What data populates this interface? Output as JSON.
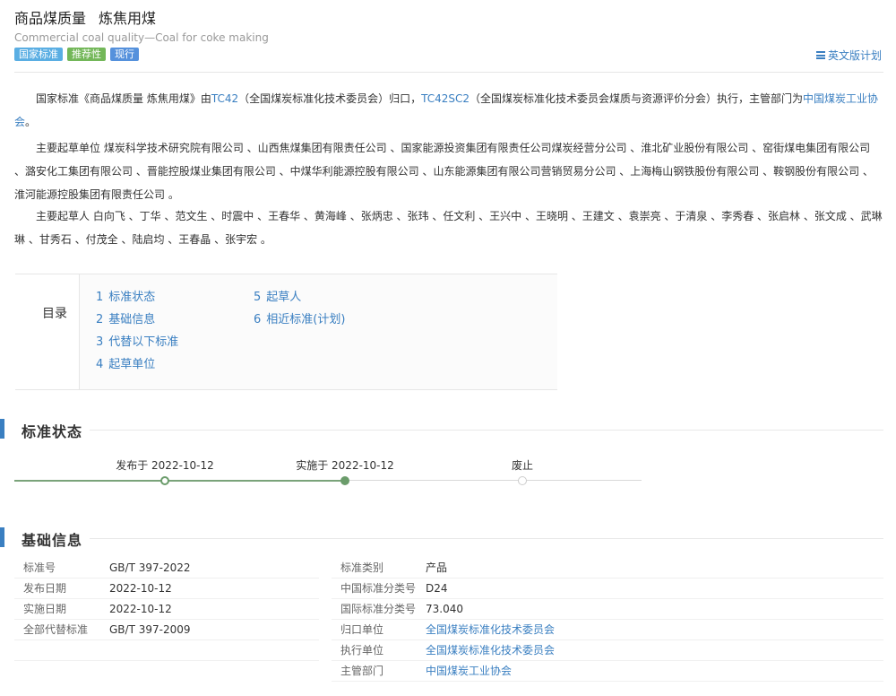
{
  "header": {
    "title_cn": "商品煤质量",
    "title_cn2": "炼焦用煤",
    "subtitle_en": "Commercial coal quality—Coal for coke making",
    "badges": [
      "国家标准",
      "推荐性",
      "现行"
    ],
    "english_plan": "英文版计划"
  },
  "intro": {
    "p1_prefix": "国家标准《商品煤质量   炼焦用煤》由",
    "p1_tc": "TC42",
    "p1_tc_desc": "（全国煤炭标准化技术委员会）归口，",
    "p1_sc": "TC42SC2",
    "p1_sc_desc": "（全国煤炭标准化技术委员会煤质与资源评价分会）执行，主管部门为",
    "p1_dept": "中国煤炭工业协会",
    "p1_end": "。",
    "p2": "主要起草单位 煤炭科学技术研究院有限公司 、山西焦煤集团有限责任公司 、国家能源投资集团有限责任公司煤炭经营分公司 、淮北矿业股份有限公司 、窑街煤电集团有限公司 、潞安化工集团有限公司 、晋能控股煤业集团有限公司 、中煤华利能源控股有限公司 、山东能源集团有限公司营销贸易分公司 、上海梅山钢铁股份有限公司 、鞍钢股份有限公司 、淮河能源控股集团有限责任公司 。",
    "p3": "主要起草人 白向飞 、丁华 、范文生 、时震中 、王春华 、黄海峰 、张炳忠 、张玮 、任文利 、王兴中 、王晓明 、王建文 、袁崇亮 、于清泉 、李秀春 、张启林 、张文成 、武琳琳 、甘秀石 、付茂全 、陆启均 、王春晶 、张宇宏 。"
  },
  "toc": {
    "label": "目录",
    "items": [
      {
        "num": "1",
        "label": "标准状态"
      },
      {
        "num": "2",
        "label": "基础信息"
      },
      {
        "num": "3",
        "label": "代替以下标准"
      },
      {
        "num": "4",
        "label": "起草单位"
      },
      {
        "num": "5",
        "label": "起草人"
      },
      {
        "num": "6",
        "label": "相近标准(计划)"
      }
    ]
  },
  "status": {
    "title": "标准状态",
    "published": "发布于 2022-10-12",
    "implemented": "实施于 2022-10-12",
    "abolished": "废止"
  },
  "basic": {
    "title": "基础信息",
    "rows": [
      {
        "k1": "标准号",
        "v1": "GB/T 397-2022",
        "k2": "标准类别",
        "v2": "产品",
        "v2_link": false
      },
      {
        "k1": "发布日期",
        "v1": "2022-10-12",
        "k2": "中国标准分类号",
        "v2": "D24",
        "v2_link": false
      },
      {
        "k1": "实施日期",
        "v1": "2022-10-12",
        "k2": "国际标准分类号",
        "v2": "73.040",
        "v2_link": false
      },
      {
        "k1": "全部代替标准",
        "v1": "GB/T 397-2009",
        "k2": "归口单位",
        "v2": "全国煤炭标准化技术委员会",
        "v2_link": true
      },
      {
        "k1": "",
        "v1": "",
        "k2": "执行单位",
        "v2": "全国煤炭标准化技术委员会",
        "v2_link": true
      },
      {
        "k1": "",
        "v1": "",
        "k2": "主管部门",
        "v2": "中国煤炭工业协会",
        "v2_link": true
      }
    ]
  },
  "colors": {
    "link": "#3a7fc1",
    "accent_bar": "#3a7fc1",
    "badge_national": "#5aaee3",
    "badge_recommended": "#73b759",
    "badge_current": "#5591dc",
    "timeline_progress": "#6b9c6b"
  },
  "icons": {
    "english_plan": "list-icon"
  }
}
